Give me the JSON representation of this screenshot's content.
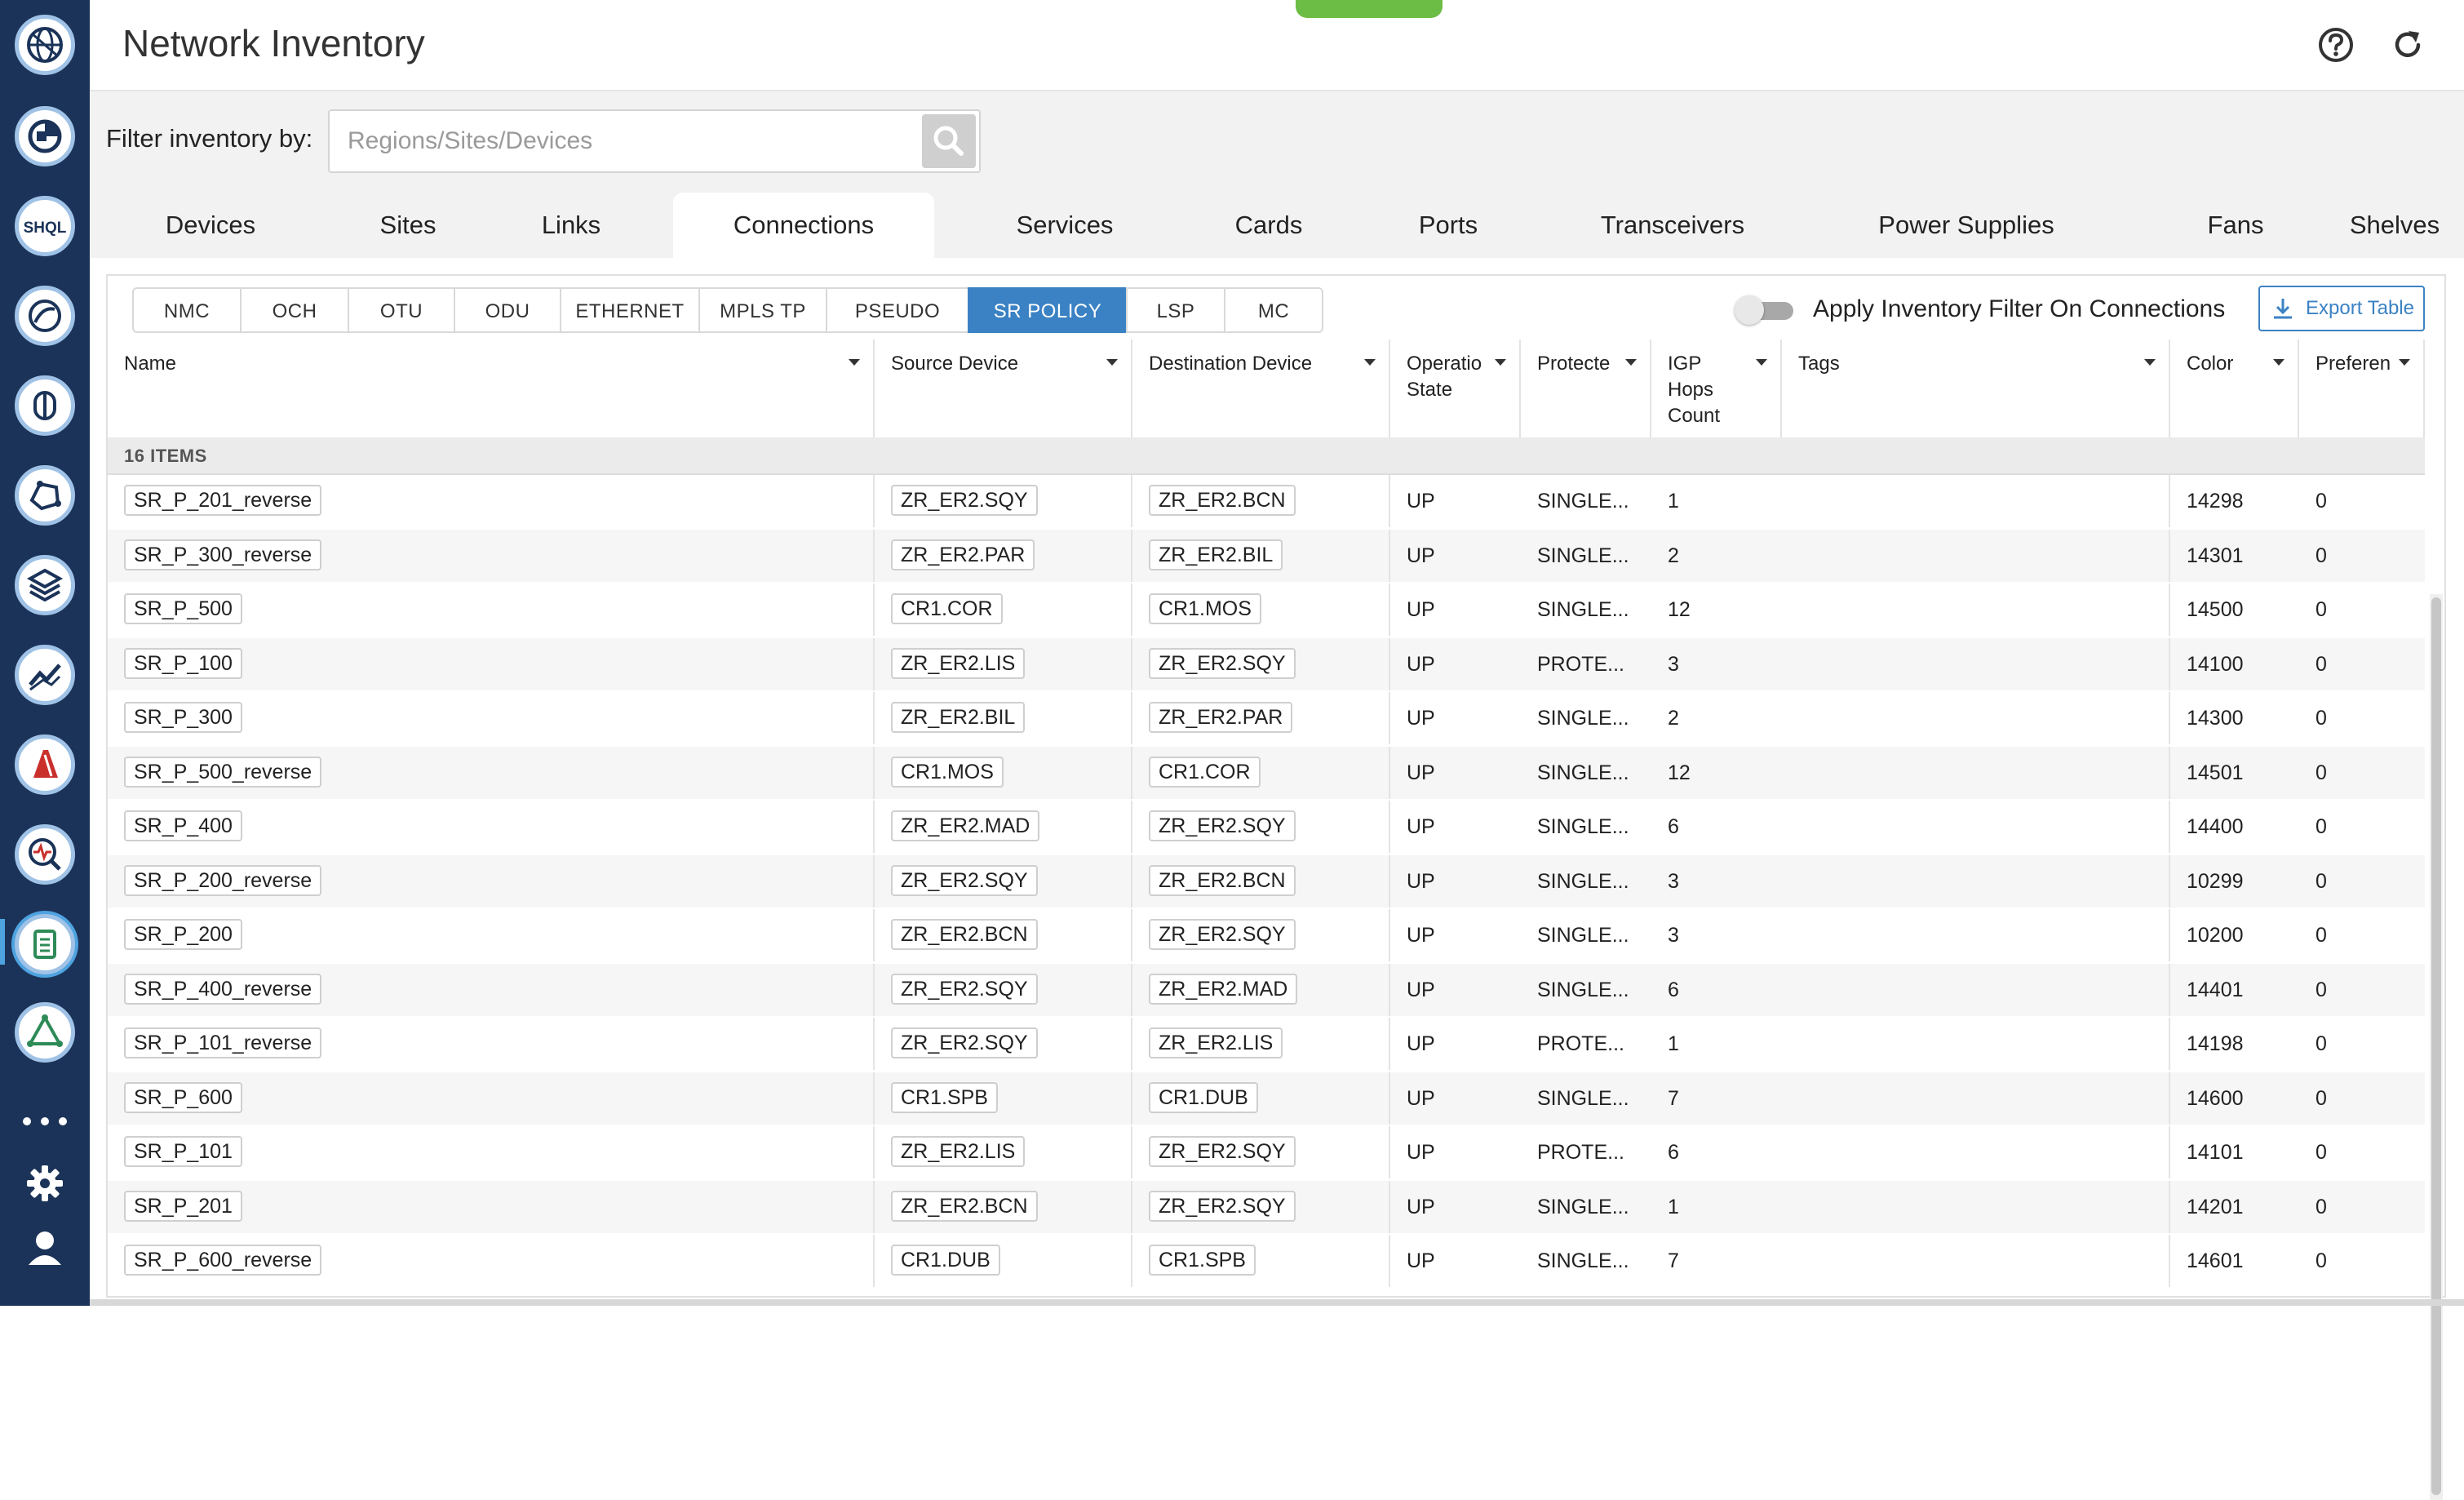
{
  "app": {
    "title": "Network Inventory"
  },
  "colors": {
    "rail_bg": "#1b3358",
    "accent": "#3b82c4",
    "green_indicator": "#6cbd45"
  },
  "rail": {
    "items": [
      {
        "icon": "globe-icon"
      },
      {
        "icon": "dashboard-icon"
      },
      {
        "icon": "shql-icon",
        "label": "SHQL"
      },
      {
        "icon": "analytics-icon"
      },
      {
        "icon": "topology-icon"
      },
      {
        "icon": "network-map-icon"
      },
      {
        "icon": "layers-icon"
      },
      {
        "icon": "trend-icon"
      },
      {
        "icon": "reports-icon"
      },
      {
        "icon": "monitor-search-icon"
      },
      {
        "icon": "inventory-icon",
        "active": true
      },
      {
        "icon": "triangle-network-icon"
      }
    ],
    "more_icon": "more-dots-icon",
    "settings_icon": "gear-icon",
    "user_icon": "user-icon"
  },
  "header": {
    "help_icon": "help-icon",
    "refresh_icon": "refresh-icon"
  },
  "filter": {
    "label": "Filter inventory by:",
    "placeholder": "Regions/Sites/Devices",
    "value": "",
    "search_icon": "search-icon"
  },
  "category_tabs": [
    {
      "label": "Devices"
    },
    {
      "label": "Sites"
    },
    {
      "label": "Links"
    },
    {
      "label": "Connections",
      "active": true
    },
    {
      "label": "Services"
    },
    {
      "label": "Cards"
    },
    {
      "label": "Ports"
    },
    {
      "label": "Transceivers"
    },
    {
      "label": "Power Supplies"
    },
    {
      "label": "Fans"
    },
    {
      "label": "Shelves"
    }
  ],
  "connection_tabs": [
    {
      "label": "NMC"
    },
    {
      "label": "OCH"
    },
    {
      "label": "OTU"
    },
    {
      "label": "ODU"
    },
    {
      "label": "ETHERNET"
    },
    {
      "label": "MPLS TP"
    },
    {
      "label": "PSEUDO WIRE"
    },
    {
      "label": "SR POLICY",
      "active": true
    },
    {
      "label": "LSP"
    },
    {
      "label": "MC"
    }
  ],
  "toggle": {
    "label": "Apply Inventory Filter On Connections",
    "on": false
  },
  "export": {
    "label": "Export Table",
    "icon": "download-icon"
  },
  "table": {
    "columns": [
      {
        "label": "Name"
      },
      {
        "label": "Source Device"
      },
      {
        "label": "Destination Device"
      },
      {
        "label": "Operatio\nState"
      },
      {
        "label": "Protecte"
      },
      {
        "label": "IGP\nHops\nCount"
      },
      {
        "label": "Tags"
      },
      {
        "label": "Color"
      },
      {
        "label": "Preferen"
      }
    ],
    "items_count": "16 ITEMS",
    "rows": [
      {
        "name": "SR_P_201_reverse",
        "source": "ZR_ER2.SQY",
        "destination": "ZR_ER2.BCN",
        "state": "UP",
        "protected": "SINGLE...",
        "hops": "1",
        "tags": "",
        "color": "14298",
        "preference": "0"
      },
      {
        "name": "SR_P_300_reverse",
        "source": "ZR_ER2.PAR",
        "destination": "ZR_ER2.BIL",
        "state": "UP",
        "protected": "SINGLE...",
        "hops": "2",
        "tags": "",
        "color": "14301",
        "preference": "0"
      },
      {
        "name": "SR_P_500",
        "source": "CR1.COR",
        "destination": "CR1.MOS",
        "state": "UP",
        "protected": "SINGLE...",
        "hops": "12",
        "tags": "",
        "color": "14500",
        "preference": "0"
      },
      {
        "name": "SR_P_100",
        "source": "ZR_ER2.LIS",
        "destination": "ZR_ER2.SQY",
        "state": "UP",
        "protected": "PROTE...",
        "hops": "3",
        "tags": "",
        "color": "14100",
        "preference": "0"
      },
      {
        "name": "SR_P_300",
        "source": "ZR_ER2.BIL",
        "destination": "ZR_ER2.PAR",
        "state": "UP",
        "protected": "SINGLE...",
        "hops": "2",
        "tags": "",
        "color": "14300",
        "preference": "0"
      },
      {
        "name": "SR_P_500_reverse",
        "source": "CR1.MOS",
        "destination": "CR1.COR",
        "state": "UP",
        "protected": "SINGLE...",
        "hops": "12",
        "tags": "",
        "color": "14501",
        "preference": "0"
      },
      {
        "name": "SR_P_400",
        "source": "ZR_ER2.MAD",
        "destination": "ZR_ER2.SQY",
        "state": "UP",
        "protected": "SINGLE...",
        "hops": "6",
        "tags": "",
        "color": "14400",
        "preference": "0"
      },
      {
        "name": "SR_P_200_reverse",
        "source": "ZR_ER2.SQY",
        "destination": "ZR_ER2.BCN",
        "state": "UP",
        "protected": "SINGLE...",
        "hops": "3",
        "tags": "",
        "color": "10299",
        "preference": "0"
      },
      {
        "name": "SR_P_200",
        "source": "ZR_ER2.BCN",
        "destination": "ZR_ER2.SQY",
        "state": "UP",
        "protected": "SINGLE...",
        "hops": "3",
        "tags": "",
        "color": "10200",
        "preference": "0"
      },
      {
        "name": "SR_P_400_reverse",
        "source": "ZR_ER2.SQY",
        "destination": "ZR_ER2.MAD",
        "state": "UP",
        "protected": "SINGLE...",
        "hops": "6",
        "tags": "",
        "color": "14401",
        "preference": "0"
      },
      {
        "name": "SR_P_101_reverse",
        "source": "ZR_ER2.SQY",
        "destination": "ZR_ER2.LIS",
        "state": "UP",
        "protected": "PROTE...",
        "hops": "1",
        "tags": "",
        "color": "14198",
        "preference": "0"
      },
      {
        "name": "SR_P_600",
        "source": "CR1.SPB",
        "destination": "CR1.DUB",
        "state": "UP",
        "protected": "SINGLE...",
        "hops": "7",
        "tags": "",
        "color": "14600",
        "preference": "0"
      },
      {
        "name": "SR_P_101",
        "source": "ZR_ER2.LIS",
        "destination": "ZR_ER2.SQY",
        "state": "UP",
        "protected": "PROTE...",
        "hops": "6",
        "tags": "",
        "color": "14101",
        "preference": "0"
      },
      {
        "name": "SR_P_201",
        "source": "ZR_ER2.BCN",
        "destination": "ZR_ER2.SQY",
        "state": "UP",
        "protected": "SINGLE...",
        "hops": "1",
        "tags": "",
        "color": "14201",
        "preference": "0"
      },
      {
        "name": "SR_P_600_reverse",
        "source": "CR1.DUB",
        "destination": "CR1.SPB",
        "state": "UP",
        "protected": "SINGLE...",
        "hops": "7",
        "tags": "",
        "color": "14601",
        "preference": "0"
      }
    ]
  }
}
